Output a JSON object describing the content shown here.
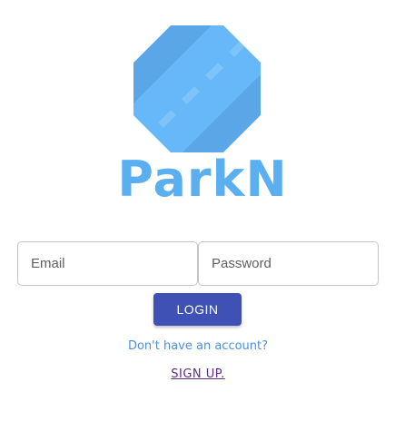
{
  "app": {
    "brand_name": "ParkN",
    "logo_icon": "road-octagon-icon"
  },
  "form": {
    "email_placeholder": "Email",
    "password_placeholder": "Password",
    "login_label": "LOGIN"
  },
  "footer": {
    "question": "Don't have an account?",
    "signup_label": "SIGN UP."
  },
  "colors": {
    "brand": "#5aaff0",
    "logo_dark": "#5aa6e6",
    "logo_light": "#66b8f8",
    "logo_dashes": "#7fc4f8",
    "button": "#3f51b5",
    "link_question": "#4a90e2",
    "link_signup": "#5b2a86"
  }
}
